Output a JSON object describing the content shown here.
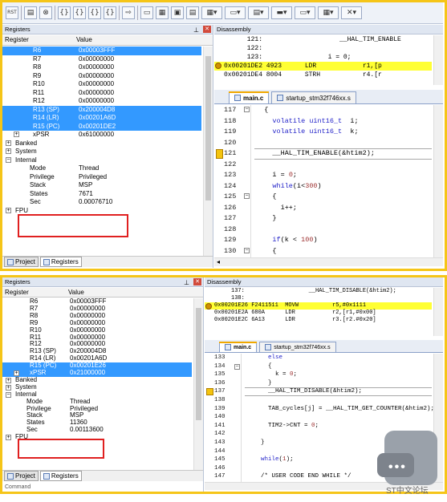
{
  "top": {
    "registers_title": "Registers",
    "col_register": "Register",
    "col_value": "Value",
    "rows": [
      {
        "name": "R6",
        "value": "0x00003FFF",
        "sel": true
      },
      {
        "name": "R7",
        "value": "0x00000000"
      },
      {
        "name": "R8",
        "value": "0x00000000"
      },
      {
        "name": "R9",
        "value": "0x00000000"
      },
      {
        "name": "R10",
        "value": "0x00000000"
      },
      {
        "name": "R11",
        "value": "0x00000000"
      },
      {
        "name": "R12",
        "value": "0x00000000"
      },
      {
        "name": "R13 (SP)",
        "value": "0x200004D8",
        "sel": true
      },
      {
        "name": "R14 (LR)",
        "value": "0x00201A6D",
        "sel": true
      },
      {
        "name": "R15 (PC)",
        "value": "0x00201DE2",
        "sel": true
      },
      {
        "name": "xPSR",
        "value": "0x61000000",
        "exp": true
      }
    ],
    "groups": [
      "Banked",
      "System",
      "Internal"
    ],
    "internal": [
      {
        "name": "Mode",
        "value": "Thread"
      },
      {
        "name": "Privilege",
        "value": "Privileged"
      },
      {
        "name": "Stack",
        "value": "MSP"
      },
      {
        "name": "States",
        "value": "7671"
      },
      {
        "name": "Sec",
        "value": "0.00076710"
      }
    ],
    "fpu": "FPU",
    "tab_project": "Project",
    "tab_registers": "Registers",
    "disasm_title": "Disassembly",
    "disasm": [
      {
        "text": "      121:                    __HAL_TIM_ENABLE"
      },
      {
        "text": "      122:"
      },
      {
        "text": "      123:                 i = 0;"
      },
      {
        "text": "0x00201DE2 4923      LDR            r1,[p",
        "hl": true
      },
      {
        "text": "0x00201DE4 8004      STRH           r4.[r"
      }
    ],
    "file_tabs": [
      "main.c",
      "startup_stm32f746xx.s"
    ],
    "code": [
      {
        "n": "117",
        "t": "  {",
        "fold": "-"
      },
      {
        "n": "118",
        "t": "    volatile uint16_t  i;"
      },
      {
        "n": "119",
        "t": "    volatile uint16_t  k;"
      },
      {
        "n": "120",
        "t": ""
      },
      {
        "n": "121",
        "t": "    __HAL_TIM_ENABLE(&htim2);",
        "cur": true
      },
      {
        "n": "122",
        "t": ""
      },
      {
        "n": "123",
        "t": "    i = 0;"
      },
      {
        "n": "124",
        "t": "    while(i<300)"
      },
      {
        "n": "125",
        "t": "    {",
        "fold": "-"
      },
      {
        "n": "126",
        "t": "      i++;"
      },
      {
        "n": "127",
        "t": "    }"
      },
      {
        "n": "128",
        "t": ""
      },
      {
        "n": "129",
        "t": "    if(k < 100)"
      },
      {
        "n": "130",
        "t": "    {",
        "fold": "-"
      }
    ]
  },
  "bottom": {
    "registers_title": "Registers",
    "col_register": "Register",
    "col_value": "Value",
    "rows": [
      {
        "name": "R6",
        "value": "0x00003FFF"
      },
      {
        "name": "R7",
        "value": "0x00000000"
      },
      {
        "name": "R8",
        "value": "0x00000000"
      },
      {
        "name": "R9",
        "value": "0x00000000"
      },
      {
        "name": "R10",
        "value": "0x00000000"
      },
      {
        "name": "R11",
        "value": "0x00000000"
      },
      {
        "name": "R12",
        "value": "0x00000000"
      },
      {
        "name": "R13 (SP)",
        "value": "0x200004D8"
      },
      {
        "name": "R14 (LR)",
        "value": "0x00201A6D"
      },
      {
        "name": "R15 (PC)",
        "value": "0x00201E26",
        "sel": true
      },
      {
        "name": "xPSR",
        "value": "0x21000000",
        "sel": true,
        "exp": true
      }
    ],
    "groups": [
      "Banked",
      "System",
      "Internal"
    ],
    "internal": [
      {
        "name": "Mode",
        "value": "Thread"
      },
      {
        "name": "Privilege",
        "value": "Privileged"
      },
      {
        "name": "Stack",
        "value": "MSP"
      },
      {
        "name": "States",
        "value": "11360"
      },
      {
        "name": "Sec",
        "value": "0.00113600"
      }
    ],
    "fpu": "FPU",
    "tab_project": "Project",
    "tab_registers": "Registers",
    "command": "Command",
    "disasm_title": "Disassembly",
    "disasm": [
      {
        "text": "     137:                   __HAL_TIM_DISABLE(&htim2);"
      },
      {
        "text": "     138:"
      },
      {
        "text": "0x00201E26 F2411511  MOVW          r5,#0x1111",
        "hl": true
      },
      {
        "text": "0x00201E2A 680A      LDR           r2,[r1,#0x00]"
      },
      {
        "text": "0x00201E2C 6A13      LDR           r3.[r2.#0x20]"
      }
    ],
    "file_tabs": [
      "main.c",
      "startup_stm32f746xx.s"
    ],
    "code": [
      {
        "n": "133",
        "t": "      else"
      },
      {
        "n": "134",
        "t": "      {",
        "fold": "-"
      },
      {
        "n": "135",
        "t": "        k = 0;"
      },
      {
        "n": "136",
        "t": "      }"
      },
      {
        "n": "137",
        "t": "      __HAL_TIM_DISABLE(&htim2);",
        "cur": true
      },
      {
        "n": "138",
        "t": ""
      },
      {
        "n": "139",
        "t": "      TAB_cycles[j] = __HAL_TIM_GET_COUNTER(&htim2);"
      },
      {
        "n": "140",
        "t": ""
      },
      {
        "n": "141",
        "t": "      TIM2->CNT = 0;"
      },
      {
        "n": "142",
        "t": ""
      },
      {
        "n": "143",
        "t": "    }"
      },
      {
        "n": "144",
        "t": ""
      },
      {
        "n": "145",
        "t": "    while(1);"
      },
      {
        "n": "146",
        "t": ""
      },
      {
        "n": "147",
        "t": "    /* USER CODE END WHILE */"
      }
    ]
  },
  "watermark": "ST中文论坛"
}
